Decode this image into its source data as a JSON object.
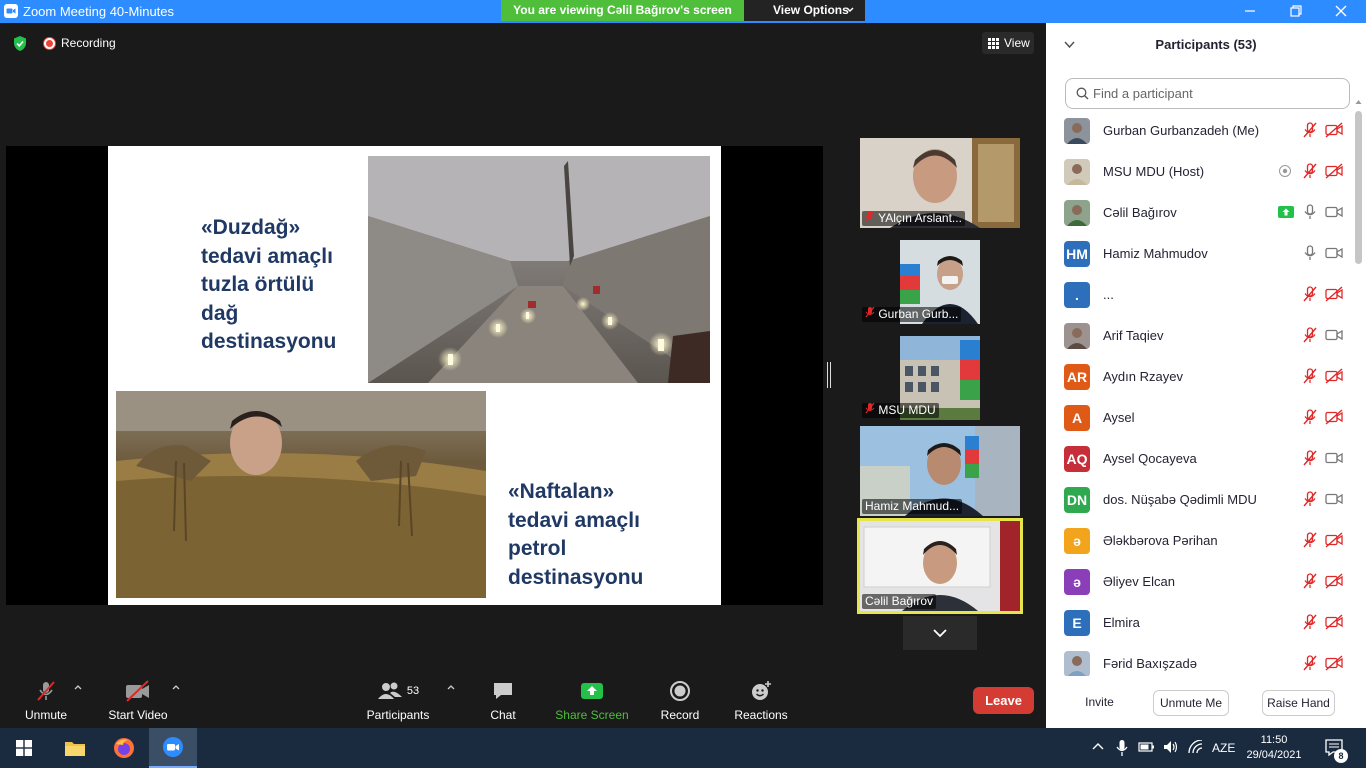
{
  "window": {
    "title": "Zoom Meeting 40-Minutes",
    "banner": "You are viewing Cəlil Bağırov's screen",
    "view_options": "View Options"
  },
  "meeting": {
    "recording_label": "Recording",
    "view_label": "View"
  },
  "slide": {
    "text_top": [
      "«Duzdağ»",
      "tedavi amaçlı",
      "tuzla örtülü",
      "dağ",
      "destinasyonu"
    ],
    "text_bottom": [
      "«Naftalan»",
      "tedavi amaçlı",
      "petrol",
      "destinasyonu"
    ]
  },
  "tiles": [
    {
      "name": "YAlçın Arslant...",
      "muted": true
    },
    {
      "name": "Gurban Gurb...",
      "muted": true
    },
    {
      "name": "MSU MDU",
      "muted": true
    },
    {
      "name": "Hamiz Mahmud...",
      "muted": false
    },
    {
      "name": "Cəlil Bağırov",
      "muted": false
    }
  ],
  "toolbar": {
    "unmute": "Unmute",
    "start_video": "Start Video",
    "participants": "Participants",
    "participants_count": "53",
    "chat": "Chat",
    "share_screen": "Share Screen",
    "record": "Record",
    "reactions": "Reactions",
    "leave": "Leave"
  },
  "panel": {
    "title": "Participants (53)",
    "search_placeholder": "Find a participant",
    "invite": "Invite",
    "unmute_me": "Unmute Me",
    "raise_hand": "Raise Hand",
    "participants": [
      {
        "name": "Gurban Gurbanzadeh (Me)",
        "avatar": "photo",
        "mic": "muted",
        "cam": "off"
      },
      {
        "name": "MSU MDU (Host)",
        "avatar": "photo",
        "mic": "muted",
        "cam": "off",
        "extra": "record-icon"
      },
      {
        "name": "Cəlil Bağırov",
        "avatar": "photo",
        "mic": "on",
        "cam": "on",
        "extra": "share-icon"
      },
      {
        "name": "Hamiz Mahmudov",
        "avatar": "HM",
        "color": "#2d6fba",
        "mic": "on",
        "cam": "on"
      },
      {
        "name": "...",
        "avatar": ".",
        "color": "#2d6fba",
        "mic": "muted",
        "cam": "off"
      },
      {
        "name": "Arif Taqiev",
        "avatar": "photo",
        "mic": "muted",
        "cam": "on"
      },
      {
        "name": "Aydın Rzayev",
        "avatar": "AR",
        "color": "#e05a17",
        "mic": "muted",
        "cam": "off"
      },
      {
        "name": "Aysel",
        "avatar": "A",
        "color": "#e05a17",
        "mic": "muted",
        "cam": "off"
      },
      {
        "name": "Aysel Qocayeva",
        "avatar": "AQ",
        "color": "#c62f3a",
        "mic": "muted",
        "cam": "on"
      },
      {
        "name": "dos. Nüşabə Qədimli MDU",
        "avatar": "DN",
        "color": "#2fa84f",
        "mic": "muted",
        "cam": "on"
      },
      {
        "name": "Ələkbərova Pərihan",
        "avatar": "ə",
        "color": "#f2a41c",
        "mic": "muted",
        "cam": "off"
      },
      {
        "name": "Əliyev Elcan",
        "avatar": "ə",
        "color": "#8a3fb8",
        "mic": "muted",
        "cam": "off"
      },
      {
        "name": "Elmira",
        "avatar": "E",
        "color": "#2d6fba",
        "mic": "muted",
        "cam": "off"
      },
      {
        "name": "Fərid Baxışzadə",
        "avatar": "photo",
        "mic": "muted",
        "cam": "off"
      }
    ]
  },
  "taskbar": {
    "language": "AZE",
    "time": "11:50",
    "date": "29/04/2021",
    "notifications": "8"
  },
  "colors": {
    "zoom_blue": "#2d8cff",
    "banner_green": "#4fbe3b",
    "leave_red": "#d33b33",
    "muted_red": "#e02828",
    "slide_text": "#1f3864"
  }
}
